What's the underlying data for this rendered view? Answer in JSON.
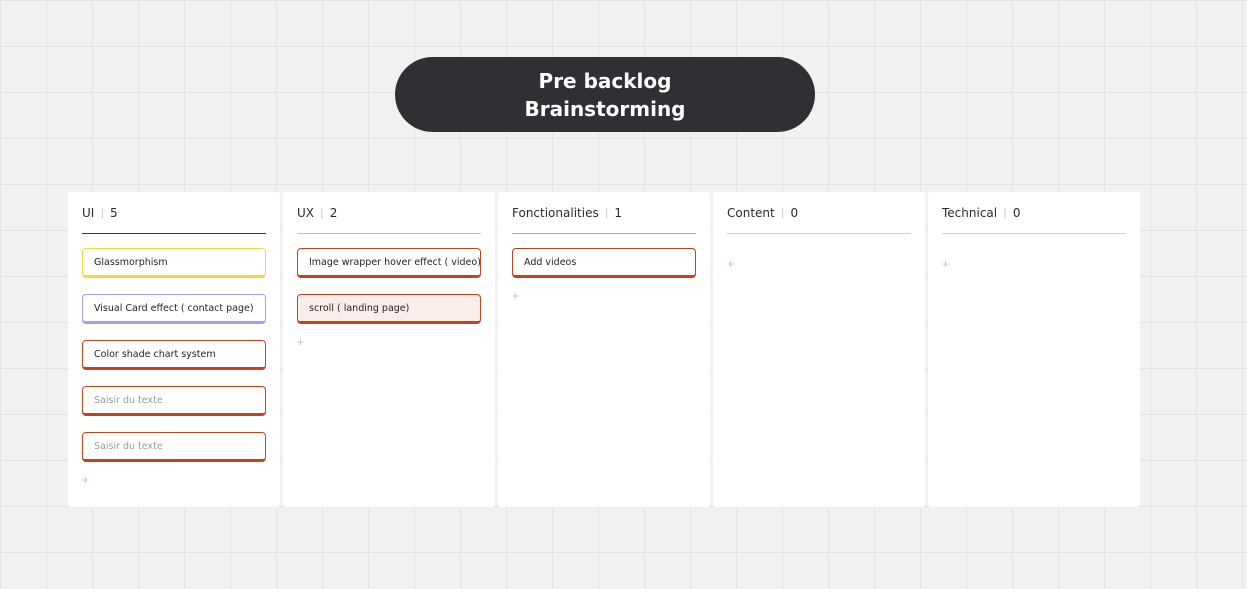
{
  "title": {
    "line1": "Pre backlog",
    "line2": "Brainstorming"
  },
  "add_symbol": "+",
  "columns": [
    {
      "name": "UI",
      "count": "5",
      "accent": "#3b3b3b",
      "cards": [
        {
          "text": "Glassmorphism",
          "color": "#f2d83a",
          "bg": "#ffffff",
          "placeholder": false
        },
        {
          "text": "Visual Card effect ( contact page)",
          "color": "#a79cf0",
          "bg": "#ffffff",
          "placeholder": false
        },
        {
          "text": "Color shade chart system",
          "color": "#c9401f",
          "bg": "#ffffff",
          "placeholder": false
        },
        {
          "text": "Saisir du texte",
          "color": "#c9401f",
          "bg": "#ffffff",
          "placeholder": true
        },
        {
          "text": "Saisir du texte",
          "color": "#c9401f",
          "bg": "#ffffff",
          "placeholder": true
        }
      ]
    },
    {
      "name": "UX",
      "count": "2",
      "accent": "#f2c230",
      "cards": [
        {
          "text": "Image wrapper hover effect ( video)",
          "color": "#c9401f",
          "bg": "#ffffff",
          "placeholder": false
        },
        {
          "text": "scroll ( landing page)",
          "color": "#c9401f",
          "bg": "#fbeeea",
          "placeholder": false
        }
      ]
    },
    {
      "name": "Fonctionalities",
      "count": "1",
      "accent": "#8cc63f",
      "cards": [
        {
          "text": "Add videos",
          "color": "#c9401f",
          "bg": "#ffffff",
          "placeholder": false
        }
      ]
    },
    {
      "name": "Content",
      "count": "0",
      "accent": "#d0d0d0",
      "cards": []
    },
    {
      "name": "Technical",
      "count": "0",
      "accent": "#d0d0d0",
      "cards": []
    }
  ]
}
